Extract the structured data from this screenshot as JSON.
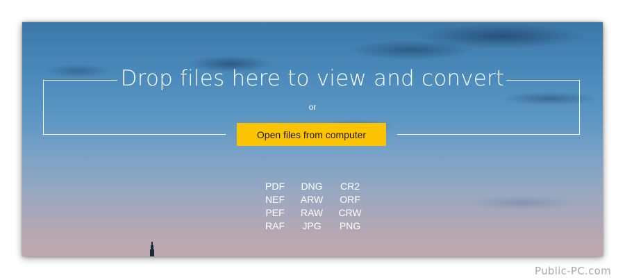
{
  "dropzone": {
    "title": "Drop files here to view and convert",
    "or_text": "or",
    "open_button_label": "Open files from computer",
    "accent_color": "#fcc400"
  },
  "formats": [
    [
      "PDF",
      "DNG",
      "CR2"
    ],
    [
      "NEF",
      "ARW",
      "ORF"
    ],
    [
      "PEF",
      "RAW",
      "CRW"
    ],
    [
      "RAF",
      "JPG",
      "PNG"
    ]
  ],
  "watermark": "Public-PC.com"
}
